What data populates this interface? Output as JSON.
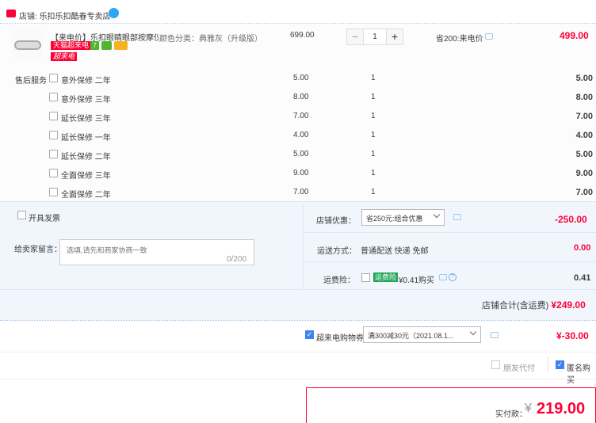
{
  "store": {
    "label": "店铺:",
    "name": "乐扣乐扣酷春专卖店"
  },
  "product": {
    "title": "【来电价】乐扣眼睛眼部按摩仪...",
    "badges": {
      "tmall": "天猫超来电",
      "gold": "7",
      "super": "超来电"
    },
    "sku": "颜色分类：典雅灰（升级版）",
    "unit_price": "699.00",
    "quantity": "1",
    "saving": "省200:来电价",
    "total": "499.00"
  },
  "services": {
    "label": "售后服务",
    "items": [
      {
        "name": "意外保修 二年",
        "price": "5.00",
        "qty": "1",
        "total": "5.00"
      },
      {
        "name": "意外保修 三年",
        "price": "8.00",
        "qty": "1",
        "total": "8.00"
      },
      {
        "name": "延长保修 三年",
        "price": "7.00",
        "qty": "1",
        "total": "7.00"
      },
      {
        "name": "延长保修 一年",
        "price": "4.00",
        "qty": "1",
        "total": "4.00"
      },
      {
        "name": "延长保修 二年",
        "price": "5.00",
        "qty": "1",
        "total": "5.00"
      },
      {
        "name": "全面保修 三年",
        "price": "9.00",
        "qty": "1",
        "total": "9.00"
      },
      {
        "name": "全面保修 二年",
        "price": "7.00",
        "qty": "1",
        "total": "7.00"
      }
    ]
  },
  "invoice": {
    "label": "开具发票"
  },
  "message": {
    "label": "给卖家留言：",
    "placeholder": "选填,请先和商家协商一致",
    "count": "0/200"
  },
  "store_coupon": {
    "label": "店铺优惠：",
    "selected": "省250元:组合优惠",
    "amount": "-250.00"
  },
  "shipping": {
    "label": "运送方式：",
    "value": "普通配送 快递 免邮",
    "amount": "0.00"
  },
  "insurance": {
    "label": "运费险：",
    "badge": "运费险",
    "value": "¥0.41购买",
    "amount": "0.41"
  },
  "subtotal": {
    "label": "店铺合计(含运费)",
    "amount": "¥249.00"
  },
  "order_coupon": {
    "label": "超来电购物券",
    "selected": "满300减30元（2021.08.1...",
    "amount": "¥-30.00"
  },
  "options": {
    "friend_pay": "朋友代付",
    "anonymous": "匿名购买"
  },
  "payment": {
    "label": "实付款：",
    "currency": "¥",
    "amount": "219.00"
  }
}
